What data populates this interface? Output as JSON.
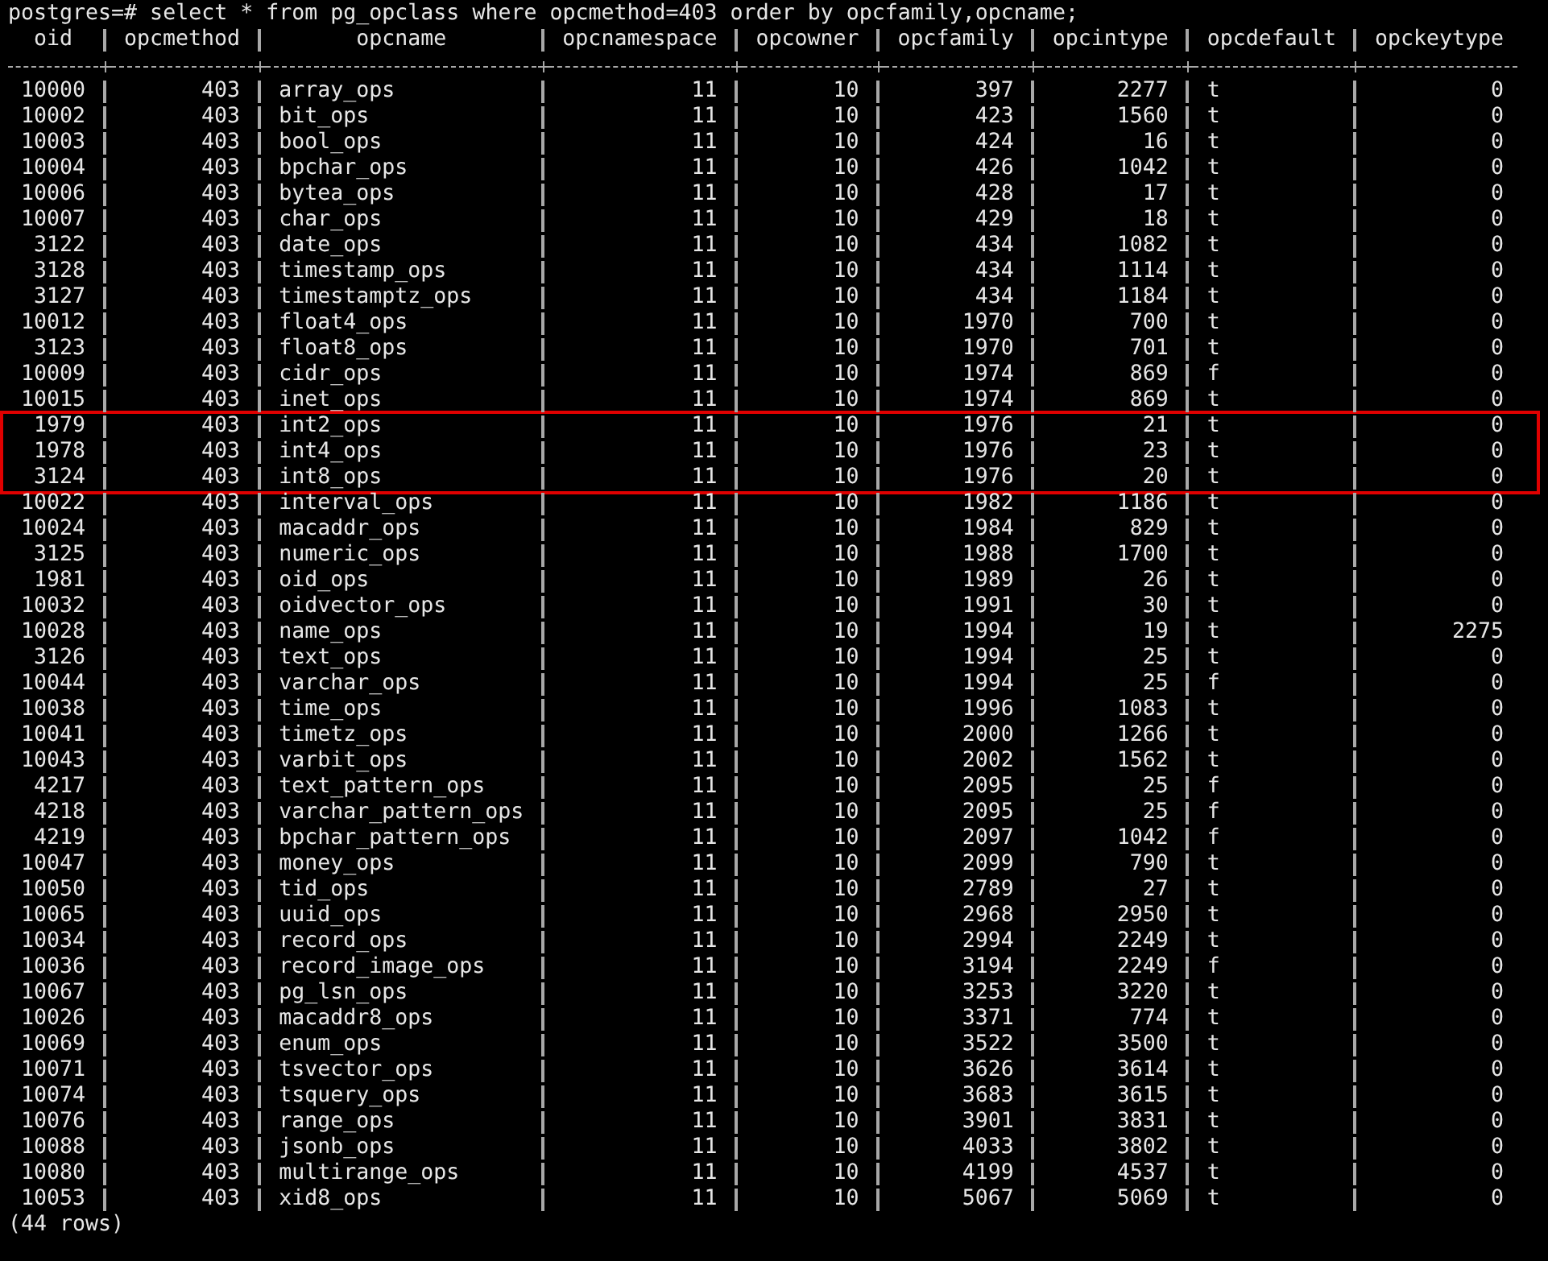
{
  "prompt": "postgres=# select * from pg_opclass where opcmethod=403 order by opcfamily,opcname;",
  "table": {
    "columns": [
      {
        "label": "oid",
        "kind": "numeric"
      },
      {
        "label": "opcmethod",
        "kind": "numeric"
      },
      {
        "label": "opcname",
        "kind": "text"
      },
      {
        "label": "opcnamespace",
        "kind": "numeric"
      },
      {
        "label": "opcowner",
        "kind": "numeric"
      },
      {
        "label": "opcfamily",
        "kind": "numeric"
      },
      {
        "label": "opcintype",
        "kind": "numeric"
      },
      {
        "label": "opcdefault",
        "kind": "text"
      },
      {
        "label": "opckeytype",
        "kind": "numeric"
      }
    ],
    "rows": [
      {
        "cells": [
          "10000",
          "403",
          "array_ops",
          "11",
          "10",
          "397",
          "2277",
          "t",
          "0"
        ],
        "highlighted": false
      },
      {
        "cells": [
          "10002",
          "403",
          "bit_ops",
          "11",
          "10",
          "423",
          "1560",
          "t",
          "0"
        ],
        "highlighted": false
      },
      {
        "cells": [
          "10003",
          "403",
          "bool_ops",
          "11",
          "10",
          "424",
          "16",
          "t",
          "0"
        ],
        "highlighted": false
      },
      {
        "cells": [
          "10004",
          "403",
          "bpchar_ops",
          "11",
          "10",
          "426",
          "1042",
          "t",
          "0"
        ],
        "highlighted": false
      },
      {
        "cells": [
          "10006",
          "403",
          "bytea_ops",
          "11",
          "10",
          "428",
          "17",
          "t",
          "0"
        ],
        "highlighted": false
      },
      {
        "cells": [
          "10007",
          "403",
          "char_ops",
          "11",
          "10",
          "429",
          "18",
          "t",
          "0"
        ],
        "highlighted": false
      },
      {
        "cells": [
          "3122",
          "403",
          "date_ops",
          "11",
          "10",
          "434",
          "1082",
          "t",
          "0"
        ],
        "highlighted": false
      },
      {
        "cells": [
          "3128",
          "403",
          "timestamp_ops",
          "11",
          "10",
          "434",
          "1114",
          "t",
          "0"
        ],
        "highlighted": false
      },
      {
        "cells": [
          "3127",
          "403",
          "timestamptz_ops",
          "11",
          "10",
          "434",
          "1184",
          "t",
          "0"
        ],
        "highlighted": false
      },
      {
        "cells": [
          "10012",
          "403",
          "float4_ops",
          "11",
          "10",
          "1970",
          "700",
          "t",
          "0"
        ],
        "highlighted": false
      },
      {
        "cells": [
          "3123",
          "403",
          "float8_ops",
          "11",
          "10",
          "1970",
          "701",
          "t",
          "0"
        ],
        "highlighted": false
      },
      {
        "cells": [
          "10009",
          "403",
          "cidr_ops",
          "11",
          "10",
          "1974",
          "869",
          "f",
          "0"
        ],
        "highlighted": false
      },
      {
        "cells": [
          "10015",
          "403",
          "inet_ops",
          "11",
          "10",
          "1974",
          "869",
          "t",
          "0"
        ],
        "highlighted": false
      },
      {
        "cells": [
          "1979",
          "403",
          "int2_ops",
          "11",
          "10",
          "1976",
          "21",
          "t",
          "0"
        ],
        "highlighted": true
      },
      {
        "cells": [
          "1978",
          "403",
          "int4_ops",
          "11",
          "10",
          "1976",
          "23",
          "t",
          "0"
        ],
        "highlighted": true
      },
      {
        "cells": [
          "3124",
          "403",
          "int8_ops",
          "11",
          "10",
          "1976",
          "20",
          "t",
          "0"
        ],
        "highlighted": true
      },
      {
        "cells": [
          "10022",
          "403",
          "interval_ops",
          "11",
          "10",
          "1982",
          "1186",
          "t",
          "0"
        ],
        "highlighted": false
      },
      {
        "cells": [
          "10024",
          "403",
          "macaddr_ops",
          "11",
          "10",
          "1984",
          "829",
          "t",
          "0"
        ],
        "highlighted": false
      },
      {
        "cells": [
          "3125",
          "403",
          "numeric_ops",
          "11",
          "10",
          "1988",
          "1700",
          "t",
          "0"
        ],
        "highlighted": false
      },
      {
        "cells": [
          "1981",
          "403",
          "oid_ops",
          "11",
          "10",
          "1989",
          "26",
          "t",
          "0"
        ],
        "highlighted": false
      },
      {
        "cells": [
          "10032",
          "403",
          "oidvector_ops",
          "11",
          "10",
          "1991",
          "30",
          "t",
          "0"
        ],
        "highlighted": false
      },
      {
        "cells": [
          "10028",
          "403",
          "name_ops",
          "11",
          "10",
          "1994",
          "19",
          "t",
          "2275"
        ],
        "highlighted": false
      },
      {
        "cells": [
          "3126",
          "403",
          "text_ops",
          "11",
          "10",
          "1994",
          "25",
          "t",
          "0"
        ],
        "highlighted": false
      },
      {
        "cells": [
          "10044",
          "403",
          "varchar_ops",
          "11",
          "10",
          "1994",
          "25",
          "f",
          "0"
        ],
        "highlighted": false
      },
      {
        "cells": [
          "10038",
          "403",
          "time_ops",
          "11",
          "10",
          "1996",
          "1083",
          "t",
          "0"
        ],
        "highlighted": false
      },
      {
        "cells": [
          "10041",
          "403",
          "timetz_ops",
          "11",
          "10",
          "2000",
          "1266",
          "t",
          "0"
        ],
        "highlighted": false
      },
      {
        "cells": [
          "10043",
          "403",
          "varbit_ops",
          "11",
          "10",
          "2002",
          "1562",
          "t",
          "0"
        ],
        "highlighted": false
      },
      {
        "cells": [
          "4217",
          "403",
          "text_pattern_ops",
          "11",
          "10",
          "2095",
          "25",
          "f",
          "0"
        ],
        "highlighted": false
      },
      {
        "cells": [
          "4218",
          "403",
          "varchar_pattern_ops",
          "11",
          "10",
          "2095",
          "25",
          "f",
          "0"
        ],
        "highlighted": false
      },
      {
        "cells": [
          "4219",
          "403",
          "bpchar_pattern_ops",
          "11",
          "10",
          "2097",
          "1042",
          "f",
          "0"
        ],
        "highlighted": false
      },
      {
        "cells": [
          "10047",
          "403",
          "money_ops",
          "11",
          "10",
          "2099",
          "790",
          "t",
          "0"
        ],
        "highlighted": false
      },
      {
        "cells": [
          "10050",
          "403",
          "tid_ops",
          "11",
          "10",
          "2789",
          "27",
          "t",
          "0"
        ],
        "highlighted": false
      },
      {
        "cells": [
          "10065",
          "403",
          "uuid_ops",
          "11",
          "10",
          "2968",
          "2950",
          "t",
          "0"
        ],
        "highlighted": false
      },
      {
        "cells": [
          "10034",
          "403",
          "record_ops",
          "11",
          "10",
          "2994",
          "2249",
          "t",
          "0"
        ],
        "highlighted": false
      },
      {
        "cells": [
          "10036",
          "403",
          "record_image_ops",
          "11",
          "10",
          "3194",
          "2249",
          "f",
          "0"
        ],
        "highlighted": false
      },
      {
        "cells": [
          "10067",
          "403",
          "pg_lsn_ops",
          "11",
          "10",
          "3253",
          "3220",
          "t",
          "0"
        ],
        "highlighted": false
      },
      {
        "cells": [
          "10026",
          "403",
          "macaddr8_ops",
          "11",
          "10",
          "3371",
          "774",
          "t",
          "0"
        ],
        "highlighted": false
      },
      {
        "cells": [
          "10069",
          "403",
          "enum_ops",
          "11",
          "10",
          "3522",
          "3500",
          "t",
          "0"
        ],
        "highlighted": false
      },
      {
        "cells": [
          "10071",
          "403",
          "tsvector_ops",
          "11",
          "10",
          "3626",
          "3614",
          "t",
          "0"
        ],
        "highlighted": false
      },
      {
        "cells": [
          "10074",
          "403",
          "tsquery_ops",
          "11",
          "10",
          "3683",
          "3615",
          "t",
          "0"
        ],
        "highlighted": false
      },
      {
        "cells": [
          "10076",
          "403",
          "range_ops",
          "11",
          "10",
          "3901",
          "3831",
          "t",
          "0"
        ],
        "highlighted": false
      },
      {
        "cells": [
          "10088",
          "403",
          "jsonb_ops",
          "11",
          "10",
          "4033",
          "3802",
          "t",
          "0"
        ],
        "highlighted": false
      },
      {
        "cells": [
          "10080",
          "403",
          "multirange_ops",
          "11",
          "10",
          "4199",
          "4537",
          "t",
          "0"
        ],
        "highlighted": false
      },
      {
        "cells": [
          "10053",
          "403",
          "xid8_ops",
          "11",
          "10",
          "5067",
          "5069",
          "t",
          "0"
        ],
        "highlighted": false
      }
    ]
  },
  "footer": "(44 rows)"
}
